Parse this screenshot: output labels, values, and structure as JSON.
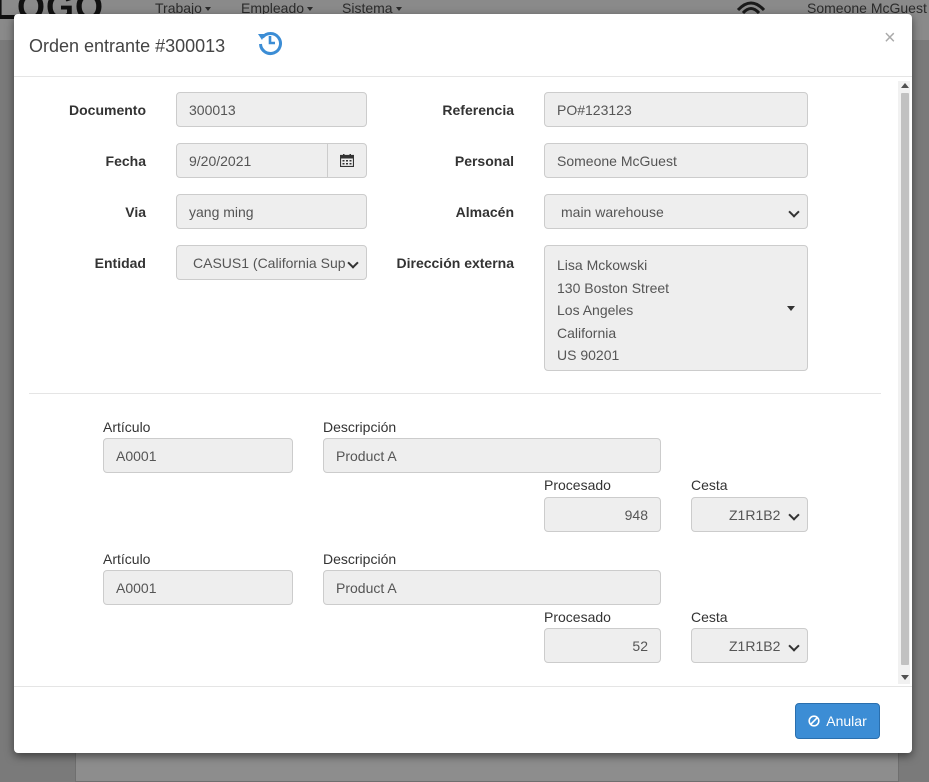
{
  "background": {
    "logo": "LOGO",
    "menu": [
      "Trabajo",
      "Empleado",
      "Sistema"
    ],
    "user": "Someone McGuest"
  },
  "modal": {
    "title": "Orden entrante #300013",
    "close_symbol": "×",
    "accent_color": "#3c8dd5"
  },
  "header_fields": {
    "documento": {
      "label": "Documento",
      "value": "300013"
    },
    "fecha": {
      "label": "Fecha",
      "value": "9/20/2021"
    },
    "via": {
      "label": "Via",
      "value": "yang ming"
    },
    "entidad": {
      "label": "Entidad",
      "value": "CASUS1 (California Sup"
    },
    "referencia": {
      "label": "Referencia",
      "value": "PO#123123"
    },
    "personal": {
      "label": "Personal",
      "value": "Someone McGuest"
    },
    "almacen": {
      "label": "Almacén",
      "value": "main warehouse"
    },
    "direccion": {
      "label": "Dirección externa",
      "lines": [
        "Lisa Mckowski",
        "130 Boston Street",
        "Los Angeles",
        "California",
        "US 90201"
      ]
    }
  },
  "lines": [
    {
      "articulo_label": "Artículo",
      "articulo": "A0001",
      "descripcion_label": "Descripción",
      "descripcion": "Product A",
      "procesado_label": "Procesado",
      "procesado": "948",
      "cesta_label": "Cesta",
      "cesta": "Z1R1B2"
    },
    {
      "articulo_label": "Artículo",
      "articulo": "A0001",
      "descripcion_label": "Descripción",
      "descripcion": "Product A",
      "procesado_label": "Procesado",
      "procesado": "52",
      "cesta_label": "Cesta",
      "cesta": "Z1R1B2"
    }
  ],
  "footer": {
    "cancel_label": "Anular"
  },
  "icons": {
    "history": "history-icon",
    "calendar": "calendar-icon",
    "cancel": "ban-icon"
  }
}
